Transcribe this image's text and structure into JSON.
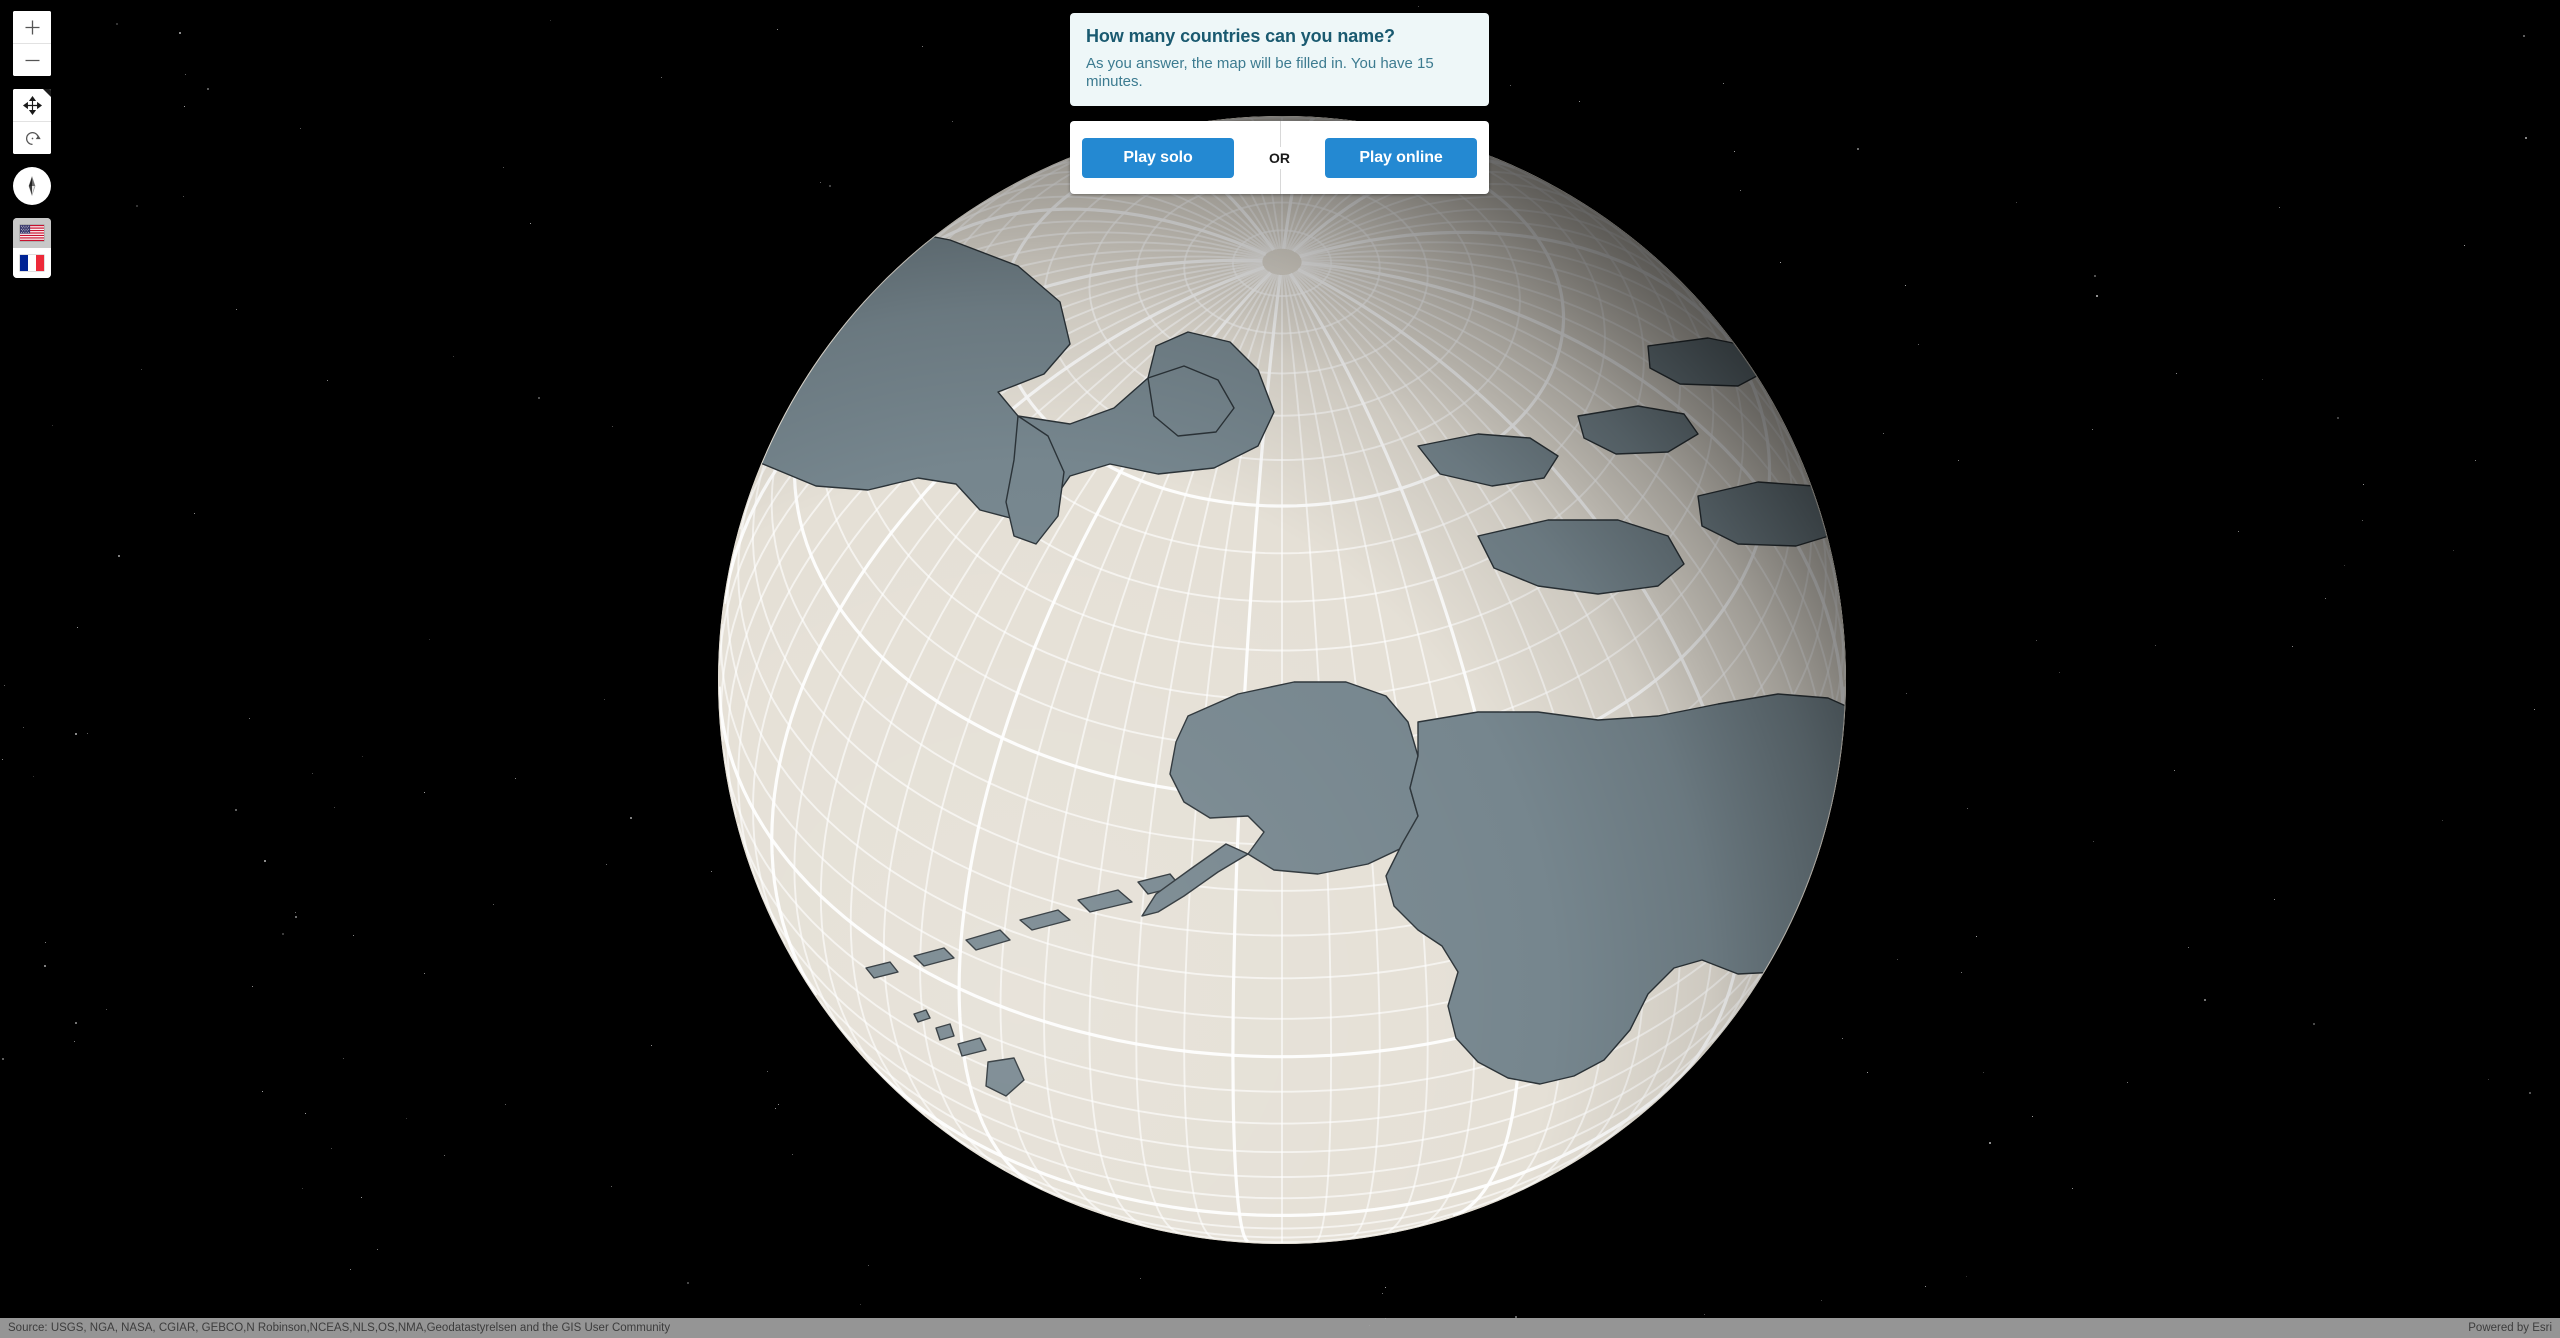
{
  "app": {
    "background_color": "#000000",
    "accent_color": "#2489d2"
  },
  "dialog": {
    "title": "How many countries can you name?",
    "subtitle": "As you answer, the map will be filled in. You have 15 minutes.",
    "play_solo_label": "Play solo",
    "or_label": "OR",
    "play_online_label": "Play online",
    "header_bg_color": "#eef7f8",
    "title_color": "#1a5a70",
    "button_color": "#2489d2"
  },
  "toolbar": {
    "zoom_in": {
      "icon": "plus-icon",
      "label": "+"
    },
    "zoom_out": {
      "icon": "minus-icon",
      "label": "−"
    },
    "pan": {
      "icon": "pan-move-icon"
    },
    "rotate": {
      "icon": "rotate-reset-icon"
    },
    "compass": {
      "icon": "compass-needle-icon"
    },
    "flags": [
      {
        "name": "united-states-flag",
        "active": false
      },
      {
        "name": "france-flag",
        "active": true
      }
    ]
  },
  "map": {
    "view": "globe",
    "ocean_color": "#e5e0d6",
    "land_color": "#76868e",
    "graticule_color": "#ffffff",
    "atmosphere_color": "#96c4ff",
    "center_region": "North America"
  },
  "attribution": {
    "source": "Source: USGS, NGA, NASA, CGIAR, GEBCO,N Robinson,NCEAS,NLS,OS,NMA,Geodatastyrelsen and the GIS User Community",
    "powered_by": "Powered by Esri"
  }
}
